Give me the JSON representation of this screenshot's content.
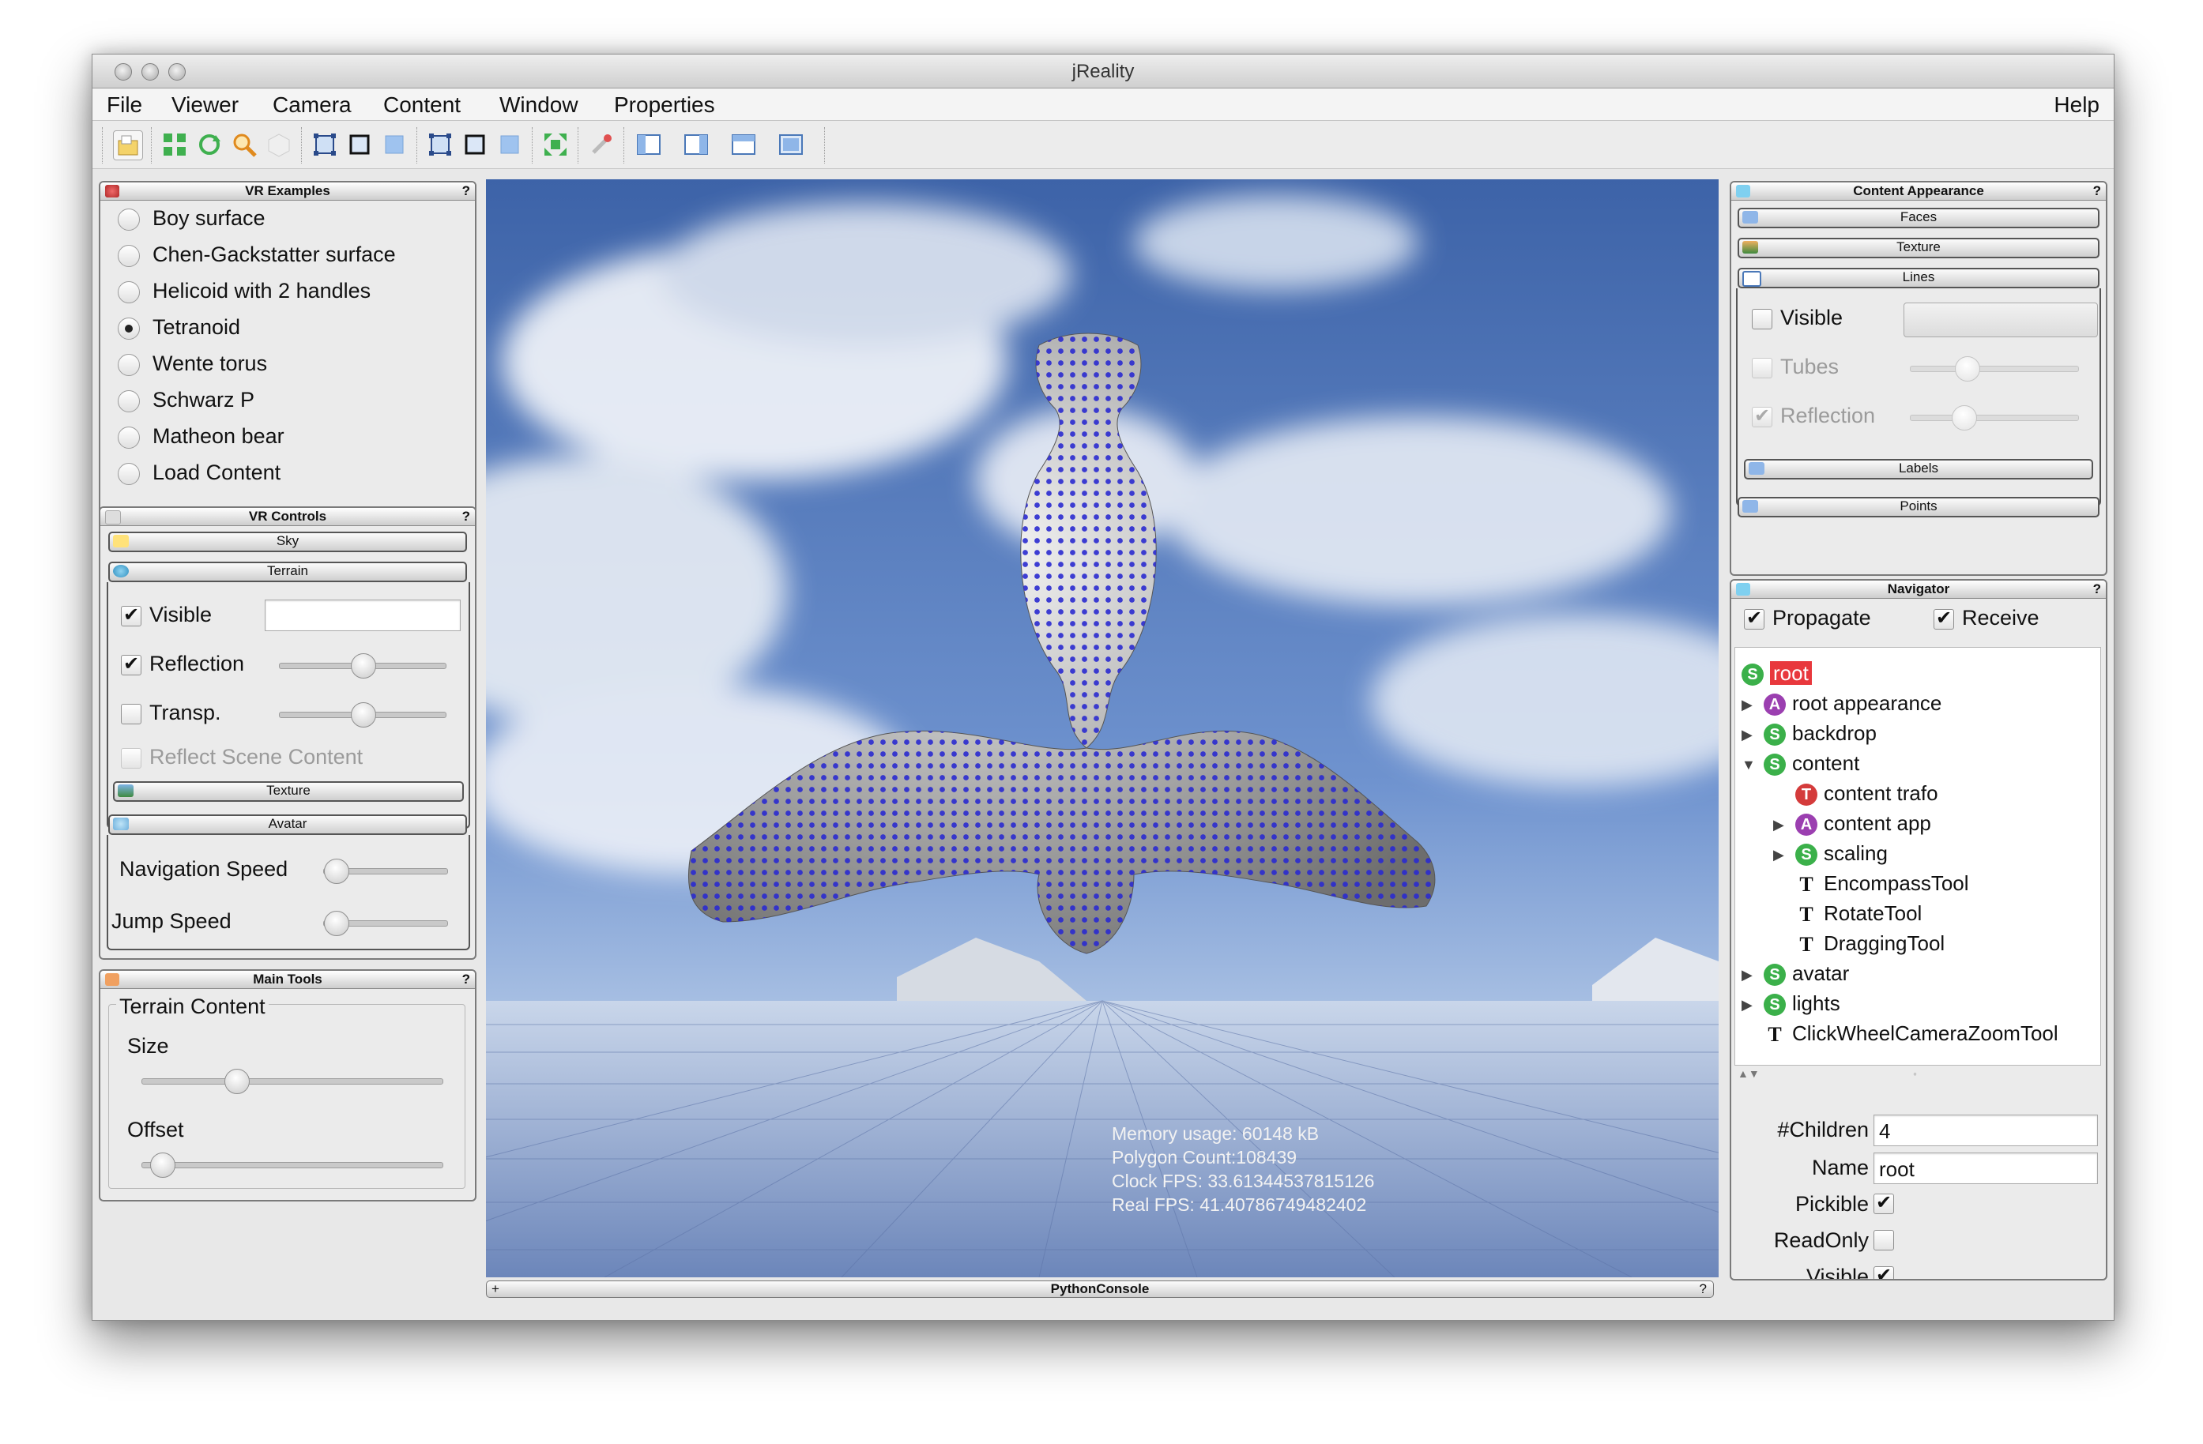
{
  "window": {
    "title": "jReality"
  },
  "menubar": {
    "items": [
      "File",
      "Viewer",
      "Camera",
      "Content",
      "Window",
      "Properties"
    ],
    "help": "Help"
  },
  "toolbar": {
    "icons": [
      "open-file-icon",
      "grid-icon",
      "rotate-icon",
      "zoom-icon",
      "cube-icon",
      "bounding-box-icon",
      "square-icon",
      "filled-square-icon",
      "bounding-box-icon",
      "square-icon",
      "filled-square-icon",
      "fit-icon",
      "pick-icon",
      "layout-left-icon",
      "layout-right-icon",
      "layout-top-icon",
      "layout-full-icon"
    ]
  },
  "vr_examples": {
    "title": "VR Examples",
    "help": "?",
    "items": [
      "Boy surface",
      "Chen-Gackstatter surface",
      "Helicoid with 2 handles",
      "Tetranoid",
      "Wente torus",
      "Schwarz P",
      "Matheon bear",
      "Load Content"
    ],
    "selected": "Tetranoid"
  },
  "vr_controls": {
    "title": "VR Controls",
    "help": "?",
    "sky": "Sky",
    "terrain": {
      "title": "Terrain",
      "visible": {
        "label": "Visible",
        "checked": true
      },
      "reflection": {
        "label": "Reflection",
        "checked": true,
        "value": 0.5
      },
      "transp": {
        "label": "Transp.",
        "checked": false,
        "value": 0.5
      },
      "reflect_scene": {
        "label": "Reflect Scene Content",
        "checked": false
      },
      "texture": "Texture"
    },
    "avatar": {
      "title": "Avatar",
      "navigation_speed": {
        "label": "Navigation Speed",
        "value": 0.08
      },
      "jump_speed": {
        "label": "Jump Speed",
        "value": 0.08
      }
    }
  },
  "main_tools": {
    "title": "Main Tools",
    "help": "?",
    "group": "Terrain Content",
    "size": {
      "label": "Size",
      "value": 0.3
    },
    "offset": {
      "label": "Offset",
      "value": 0.06
    }
  },
  "viewport": {
    "stats": {
      "memory": "Memory usage: 60148 kB",
      "polygons": "Polygon Count:108439",
      "clock_fps": "Clock FPS: 33.61344537815126",
      "real_fps": "Real FPS: 41.40786749482402"
    },
    "console": {
      "label": "PythonConsole",
      "plus": "+",
      "help": "?"
    }
  },
  "content_appearance": {
    "title": "Content Appearance",
    "help": "?",
    "faces": "Faces",
    "texture": "Texture",
    "lines": "Lines",
    "visible": {
      "label": "Visible",
      "checked": false
    },
    "tubes": {
      "label": "Tubes",
      "checked": false,
      "value": 0.3
    },
    "reflection": {
      "label": "Reflection",
      "checked": true,
      "value": 0.3
    },
    "labels": "Labels",
    "points": "Points"
  },
  "navigator": {
    "title": "Navigator",
    "help": "?",
    "propagate": {
      "label": "Propagate",
      "checked": true
    },
    "receive": {
      "label": "Receive",
      "checked": true
    },
    "tree": [
      {
        "label": "root",
        "type": "S",
        "depth": 0,
        "arrow": "",
        "selected": true
      },
      {
        "label": "root appearance",
        "type": "A",
        "depth": 0,
        "arrow": "▶"
      },
      {
        "label": "backdrop",
        "type": "S",
        "depth": 0,
        "arrow": "▶"
      },
      {
        "label": "content",
        "type": "S",
        "depth": 0,
        "arrow": "▼"
      },
      {
        "label": "content trafo",
        "type": "T",
        "depth": 1,
        "arrow": ""
      },
      {
        "label": "content app",
        "type": "A",
        "depth": 1,
        "arrow": "▶"
      },
      {
        "label": "scaling",
        "type": "S",
        "depth": 1,
        "arrow": "▶"
      },
      {
        "label": "EncompassTool",
        "type": "tool",
        "depth": 1,
        "arrow": ""
      },
      {
        "label": "RotateTool",
        "type": "tool",
        "depth": 1,
        "arrow": ""
      },
      {
        "label": "DraggingTool",
        "type": "tool",
        "depth": 1,
        "arrow": ""
      },
      {
        "label": "avatar",
        "type": "S",
        "depth": 0,
        "arrow": "▶"
      },
      {
        "label": "lights",
        "type": "S",
        "depth": 0,
        "arrow": "▶"
      },
      {
        "label": "ClickWheelCameraZoomTool",
        "type": "tool",
        "depth": 0,
        "arrow": ""
      }
    ],
    "properties": {
      "children": {
        "label": "#Children",
        "value": "4"
      },
      "name": {
        "label": "Name",
        "value": "root"
      },
      "pickible": {
        "label": "Pickible",
        "checked": true
      },
      "readonly": {
        "label": "ReadOnly",
        "checked": false
      },
      "visible": {
        "label": "Visible",
        "checked": true
      }
    }
  },
  "colors": {
    "selection": "#e8383d",
    "scene_node": "#3bb04a",
    "appearance_node": "#9b3fb0",
    "transform_node": "#d43b3b",
    "point_dots": "#2a2ad0"
  }
}
